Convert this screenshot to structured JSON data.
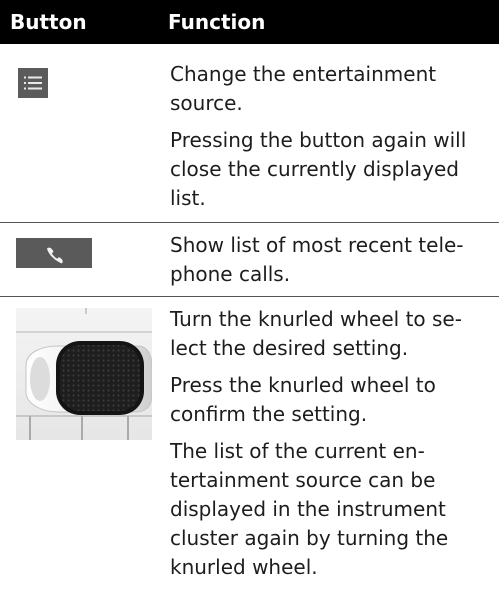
{
  "header": {
    "button_label": "Button",
    "function_label": "Function"
  },
  "rows": [
    {
      "icon": "list-menu-icon",
      "paragraphs": [
        "Change the entertainment source.",
        "Pressing the button again will close the currently displayed list."
      ]
    },
    {
      "icon": "phone-icon",
      "paragraphs": [
        "Show list of most recent tele-phone calls."
      ]
    },
    {
      "icon": "knurled-wheel-image",
      "paragraphs": [
        "Turn the knurled wheel to se-lect the desired setting.",
        "Press the knurled wheel to confirm the setting.",
        "The list of the current en-tertainment source can be displayed in the instrument cluster again by turning the knurled wheel."
      ]
    }
  ]
}
